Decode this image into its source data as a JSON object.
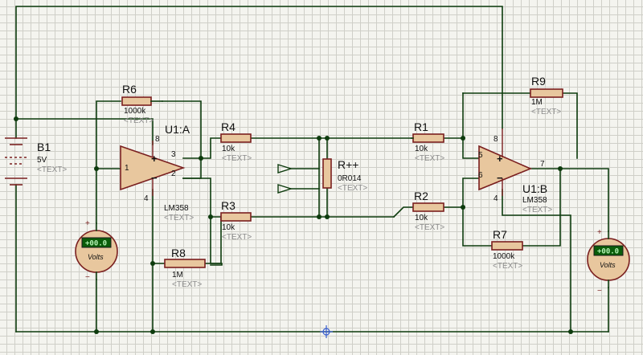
{
  "battery": {
    "ref": "B1",
    "value": "5V",
    "text": "<TEXT>"
  },
  "opamp_a": {
    "ref": "U1:A",
    "part": "LM358",
    "text": "<TEXT>",
    "pins": [
      "3",
      "2",
      "1",
      "8",
      "4"
    ]
  },
  "opamp_b": {
    "ref": "U1:B",
    "part": "LM358",
    "text": "<TEXT>",
    "pins": [
      "5",
      "6",
      "7",
      "8",
      "4"
    ]
  },
  "resistors": {
    "r1": {
      "ref": "R1",
      "value": "10k",
      "text": "<TEXT>"
    },
    "r2": {
      "ref": "R2",
      "value": "10k",
      "text": "<TEXT>"
    },
    "r3": {
      "ref": "R3",
      "value": "10k",
      "text": "<TEXT>"
    },
    "r4": {
      "ref": "R4",
      "value": "10k",
      "text": "<TEXT>"
    },
    "r6": {
      "ref": "R6",
      "value": "1000k",
      "text": "<TEXT>"
    },
    "r7": {
      "ref": "R7",
      "value": "1000k",
      "text": "<TEXT>"
    },
    "r8": {
      "ref": "R8",
      "value": "1M",
      "text": "<TEXT>"
    },
    "r9": {
      "ref": "R9",
      "value": "1M",
      "text": "<TEXT>"
    },
    "rpp": {
      "ref": "R++",
      "value": "0R014",
      "text": "<TEXT>"
    }
  },
  "voltmeters": [
    {
      "unit": "Volts",
      "reading": "+00.0",
      "plus": "+",
      "minus": "−"
    },
    {
      "unit": "Volts",
      "reading": "+00.0",
      "plus": "+",
      "minus": "−"
    }
  ],
  "signs": {
    "plus": "+",
    "minus": "−"
  },
  "colors": {
    "wire": "#0d3b0d",
    "component": "#7a1f1f",
    "body": "#e8c79e",
    "grid": "#cfcfc8",
    "lcd": "#0a5c0a"
  }
}
